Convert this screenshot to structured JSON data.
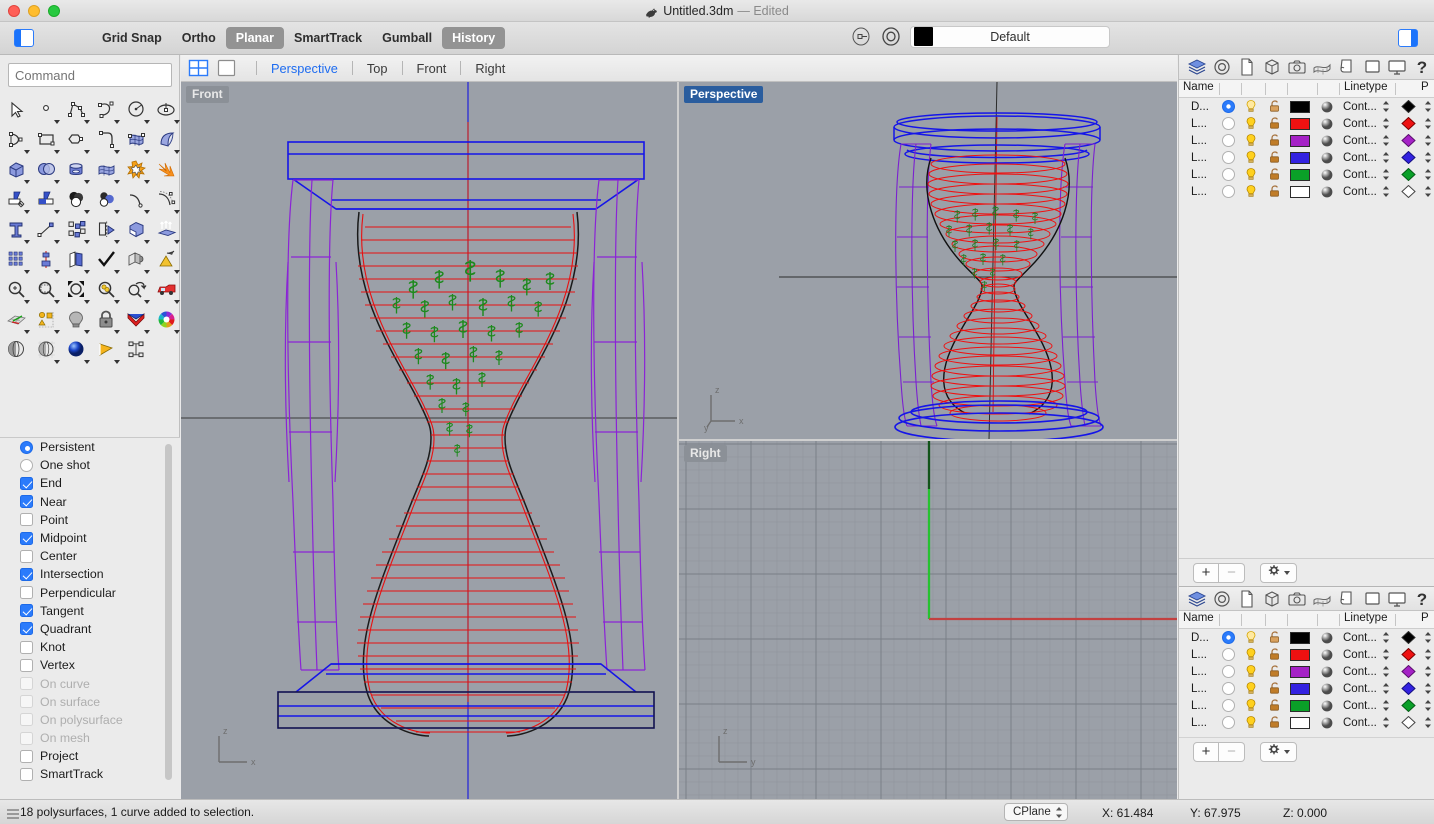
{
  "window": {
    "title": "Untitled.3dm",
    "edited_suffix": "— Edited",
    "app_icon": "rhino-icon"
  },
  "toolbar": {
    "left_panel_toggle": "left-sidebar-toggle",
    "right_panel_toggle": "right-sidebar-toggle",
    "modes": [
      {
        "label": "Grid Snap",
        "active": false
      },
      {
        "label": "Ortho",
        "active": false
      },
      {
        "label": "Planar",
        "active": true
      },
      {
        "label": "SmartTrack",
        "active": false
      },
      {
        "label": "Gumball",
        "active": false
      },
      {
        "label": "History",
        "active": true
      }
    ],
    "layer_icon": "layer-target-icon",
    "object_icon": "object-target-icon",
    "material": {
      "label": "Default",
      "swatch": "#000000"
    }
  },
  "command": {
    "placeholder": "Command",
    "value": ""
  },
  "tools": {
    "rows": [
      [
        "select-arrow-icon",
        "point-icon",
        "polyline-icon",
        "curve-icon",
        "circle-icon",
        "ellipse-icon"
      ],
      [
        "arc-icon",
        "rectangle-icon",
        "polygon-icon",
        "fillet-icon",
        "surface-grid-icon",
        "surface-sweep-icon"
      ],
      [
        "box-icon",
        "boolean-union-icon",
        "cylinder-icon",
        "mesh-icon",
        "explode-icon",
        "star-burst-icon"
      ],
      [
        "trim-icon",
        "split-icon",
        "boolean-difference-icon",
        "boolean-intersect-icon",
        "blend-curve-icon",
        "offset-curve-icon"
      ],
      [
        "text-icon",
        "move-icon",
        "array-icon",
        "mirror-icon",
        "cplane-box-icon",
        "extrude-icon"
      ],
      [
        "grid-array-icon",
        "scale-icon",
        "rotate-copy-icon",
        "check-icon",
        "unroll-icon",
        "drafting-icon"
      ],
      [
        "zoom-icon",
        "zoom-window-icon",
        "zoom-extents-icon",
        "zoom-selected-icon",
        "undo-view-icon",
        "named-view-icon"
      ],
      [
        "cplane-grid-icon",
        "analyze-icon",
        "light-icon",
        "lock-icon",
        "render-icon",
        "color-wheel-icon"
      ],
      [
        "shade-icon",
        "ghosted-icon",
        "rendered-icon",
        "camera-icon",
        "block-icon",
        ""
      ]
    ]
  },
  "osnap": {
    "modes": [
      {
        "label": "Persistent",
        "type": "radio",
        "checked": true,
        "disabled": false
      },
      {
        "label": "One shot",
        "type": "radio",
        "checked": false,
        "disabled": false
      },
      {
        "label": "End",
        "type": "check",
        "checked": true,
        "disabled": false
      },
      {
        "label": "Near",
        "type": "check",
        "checked": true,
        "disabled": false
      },
      {
        "label": "Point",
        "type": "check",
        "checked": false,
        "disabled": false
      },
      {
        "label": "Midpoint",
        "type": "check",
        "checked": true,
        "disabled": false
      },
      {
        "label": "Center",
        "type": "check",
        "checked": false,
        "disabled": false
      },
      {
        "label": "Intersection",
        "type": "check",
        "checked": true,
        "disabled": false
      },
      {
        "label": "Perpendicular",
        "type": "check",
        "checked": false,
        "disabled": false
      },
      {
        "label": "Tangent",
        "type": "check",
        "checked": true,
        "disabled": false
      },
      {
        "label": "Quadrant",
        "type": "check",
        "checked": true,
        "disabled": false
      },
      {
        "label": "Knot",
        "type": "check",
        "checked": false,
        "disabled": false
      },
      {
        "label": "Vertex",
        "type": "check",
        "checked": false,
        "disabled": false
      },
      {
        "label": "On curve",
        "type": "check",
        "checked": false,
        "disabled": true
      },
      {
        "label": "On surface",
        "type": "check",
        "checked": false,
        "disabled": true
      },
      {
        "label": "On polysurface",
        "type": "check",
        "checked": false,
        "disabled": true
      },
      {
        "label": "On mesh",
        "type": "check",
        "checked": false,
        "disabled": true
      },
      {
        "label": "Project",
        "type": "check",
        "checked": false,
        "disabled": false
      },
      {
        "label": "SmartTrack",
        "type": "check",
        "checked": false,
        "disabled": false
      }
    ]
  },
  "viewtabs": {
    "four_view_icon": "four-view-layout-icon",
    "single_view_icon": "single-view-layout-icon",
    "names": [
      {
        "label": "Perspective",
        "active": true
      },
      {
        "label": "Top",
        "active": false
      },
      {
        "label": "Front",
        "active": false
      },
      {
        "label": "Right",
        "active": false
      }
    ]
  },
  "viewports": [
    {
      "name": "Front",
      "active": false,
      "axes": [
        "z",
        "x"
      ]
    },
    {
      "name": "Perspective",
      "active": true,
      "axes": [
        "z",
        "y",
        "x"
      ]
    },
    {
      "name": "Right",
      "active": false,
      "axes": [
        "z",
        "y"
      ]
    }
  ],
  "layer_panel": {
    "icons": [
      "layers-icon",
      "properties-icon",
      "document-icon",
      "object-icon",
      "camera-icon",
      "mesh-icon",
      "display-icon",
      "named-view-icon",
      "monitor-icon",
      "help-icon"
    ],
    "columns": [
      "Name",
      "Linetype",
      "P"
    ],
    "rows": [
      {
        "name": "D...",
        "current": true,
        "visible": true,
        "locked": false,
        "color": "#000000",
        "linetype": "Cont...",
        "print_color": "#000000"
      },
      {
        "name": "L...",
        "current": false,
        "visible": true,
        "locked": false,
        "color": "#ee1111",
        "linetype": "Cont...",
        "print_color": "#ee1111"
      },
      {
        "name": "L...",
        "current": false,
        "visible": true,
        "locked": false,
        "color": "#a522c6",
        "linetype": "Cont...",
        "print_color": "#a522c6"
      },
      {
        "name": "L...",
        "current": false,
        "visible": true,
        "locked": false,
        "color": "#3322e0",
        "linetype": "Cont...",
        "print_color": "#3322e0"
      },
      {
        "name": "L...",
        "current": false,
        "visible": true,
        "locked": false,
        "color": "#0aa028",
        "linetype": "Cont...",
        "print_color": "#0aa028"
      },
      {
        "name": "L...",
        "current": false,
        "visible": true,
        "locked": false,
        "color": "#ffffff",
        "linetype": "Cont...",
        "print_color": "#ffffff"
      }
    ],
    "footer": {
      "add": "+",
      "remove": "−",
      "options": "gear-icon"
    }
  },
  "statusbar": {
    "message": "18 polysurfaces, 1 curve added to selection.",
    "cplane_label": "CPlane",
    "x": "X: 61.484",
    "y": "Y: 67.975",
    "z": "Z: 0.000"
  }
}
